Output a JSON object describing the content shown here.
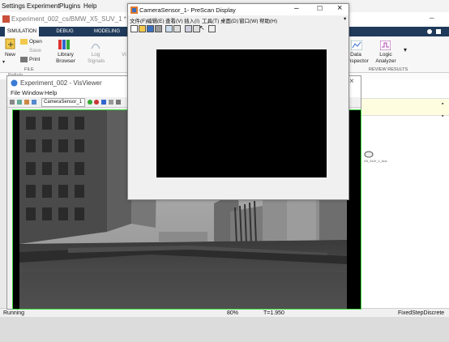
{
  "top_menu": [
    "Settings",
    "Experiment",
    "Plugins",
    "Help"
  ],
  "simulink": {
    "title": "Experiment_002_cs/BMW_X5_SUV_1 * - Simulink",
    "tabs": [
      "SIMULATION",
      "DEBUG",
      "MODELING"
    ],
    "ribbon": {
      "new": "New",
      "open": "Open",
      "save": "Save",
      "print": "Print",
      "library_browser": "Library Browser",
      "log_signals": "Log Signals",
      "data_inspector": "Data Inspector",
      "logic_analyzer": "Logic Analyzer"
    },
    "sections": {
      "file": "FILE",
      "review_results": "REVIEW RESULTS"
    },
    "breadcrumb": "Prefixdo",
    "block_label": "X5_SUV_1_bus",
    "status": {
      "left": "Running",
      "zoom": "80%",
      "time": "T=1.950",
      "solver": "FixedStepDiscrete"
    },
    "accent": "#1f3a5a"
  },
  "visviewer": {
    "title": "Experiment_002 - VisViewer",
    "menu": [
      "File",
      "Window",
      "Help"
    ],
    "camera_select": "CameraSensor_1",
    "border_color": "#3fdc3f"
  },
  "prescan_display": {
    "title": "CameraSensor_1- PreScan Display",
    "menu": [
      "文件(F)",
      "编辑(E)",
      "查看(V)",
      "插入(I)",
      "工具(T)",
      "桌面(D)",
      "窗口(W)",
      "帮助(H)"
    ]
  },
  "icons": [
    "minimize-icon",
    "maximize-icon",
    "close-icon",
    "new-icon",
    "open-icon",
    "save-icon",
    "print-icon",
    "zoom-icon",
    "pointer-icon"
  ]
}
